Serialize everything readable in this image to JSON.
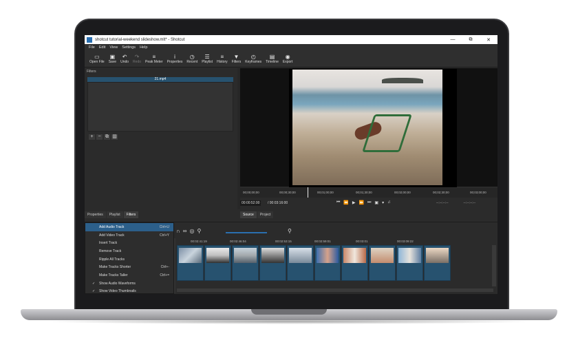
{
  "window": {
    "title": "shotcut tutorial-weekend slideshow.mlt* - Shotcut",
    "controls": [
      "—",
      "⧉",
      "✕"
    ]
  },
  "menu": [
    "File",
    "Edit",
    "View",
    "Settings",
    "Help"
  ],
  "toolbar": [
    {
      "label": "Open File",
      "icon": "folder-icon",
      "glyph": "▭"
    },
    {
      "label": "Save",
      "icon": "save-icon",
      "glyph": "▣"
    },
    {
      "label": "Undo",
      "icon": "undo-icon",
      "glyph": "↶"
    },
    {
      "label": "Redo",
      "icon": "redo-icon",
      "glyph": "↷",
      "disabled": true
    },
    {
      "label": "Peak Meter",
      "icon": "meter-icon",
      "glyph": "≡"
    },
    {
      "label": "Properties",
      "icon": "info-icon",
      "glyph": "i"
    },
    {
      "label": "Recent",
      "icon": "clock-icon",
      "glyph": "◷"
    },
    {
      "label": "Playlist",
      "icon": "list-icon",
      "glyph": "☰"
    },
    {
      "label": "History",
      "icon": "history-icon",
      "glyph": "≡"
    },
    {
      "label": "Filters",
      "icon": "filter-icon",
      "glyph": "▼"
    },
    {
      "label": "Keyframes",
      "icon": "stopwatch-icon",
      "glyph": "◴"
    },
    {
      "label": "Timeline",
      "icon": "timeline-icon",
      "glyph": "▤"
    },
    {
      "label": "Export",
      "icon": "export-icon",
      "glyph": "◉"
    }
  ],
  "filters": {
    "title": "Filters",
    "file": "21.mp4",
    "buttons": [
      "+",
      "−",
      "⧉",
      "▥"
    ]
  },
  "left_tabs": [
    "Properties",
    "Playlist",
    "Filters"
  ],
  "player": {
    "ruler": [
      "00;00;00;00",
      "00;00;30;00",
      "00;01;00;00",
      "00;01;30;00",
      "00;02;00;00",
      "00;02;30;00",
      "00;03;00;00"
    ],
    "timecode": "00:00:52:00",
    "duration": "/ 00:03:16:00",
    "in_point": "--:--:--:--",
    "out_point": "--:--:--:--",
    "transport": [
      "⏮",
      "⏪",
      "▶",
      "⏩",
      "⏭",
      "▣",
      "▾",
      "♫"
    ]
  },
  "source_tabs": [
    "Source",
    "Project"
  ],
  "timeline": {
    "ruler": [
      "00:02:41:19",
      "00:02:46:04",
      "00:02:53:15",
      "00:02:59:01",
      "00:03:01",
      "00:03:09:22"
    ],
    "clip_count": 10
  },
  "context_menu": [
    {
      "label": "Add Audio Track",
      "shortcut": "Ctrl+U",
      "highlight": true
    },
    {
      "label": "Add Video Track",
      "shortcut": "Ctrl+Y"
    },
    {
      "label": "Insert Track",
      "shortcut": ""
    },
    {
      "label": "Remove Track",
      "shortcut": ""
    },
    {
      "label": "Ripple All Tracks",
      "shortcut": ""
    },
    {
      "label": "Make Tracks Shorter",
      "shortcut": "Ctrl+-"
    },
    {
      "label": "Make Tracks Taller",
      "shortcut": "Ctrl+="
    },
    {
      "label": "Show Audio Waveforms",
      "shortcut": "",
      "checked": true
    },
    {
      "label": "Show Video Thumbnails",
      "shortcut": "",
      "checked": true
    }
  ]
}
